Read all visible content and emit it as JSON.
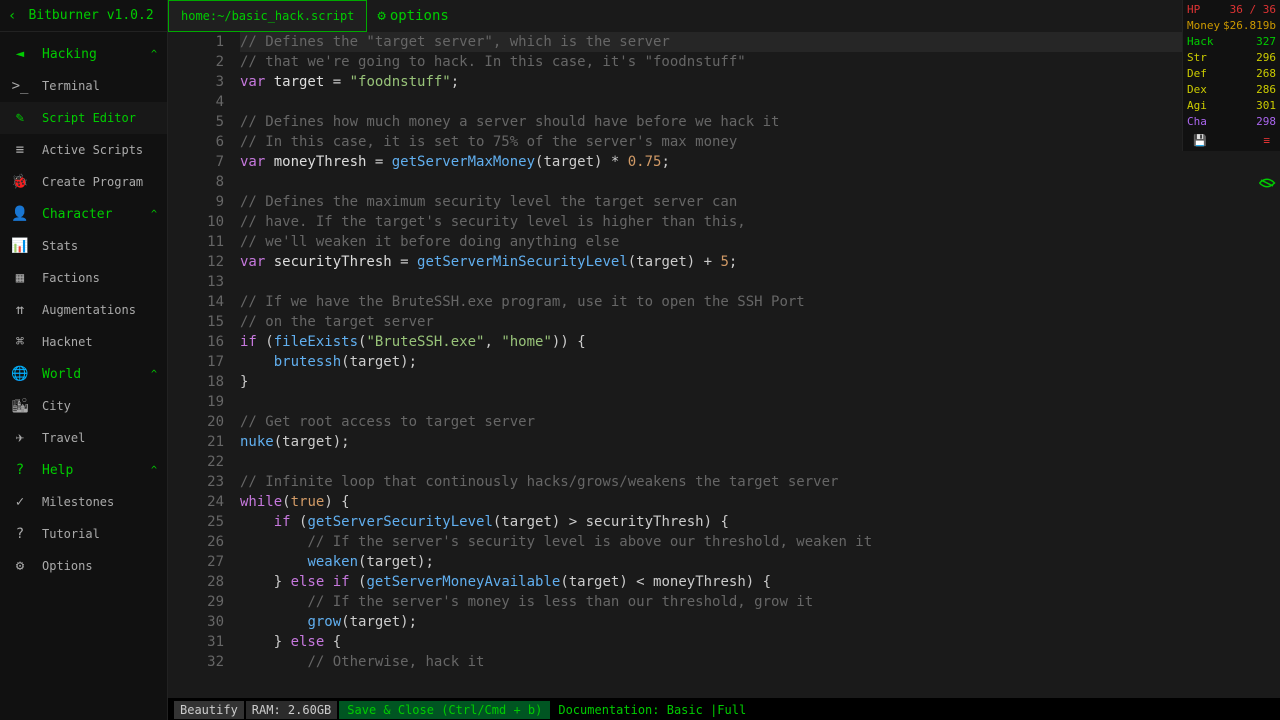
{
  "title": "Bitburner v1.0.2",
  "tab": {
    "path": "home:~/basic_hack.script",
    "options": "options"
  },
  "sidebar": {
    "groups": [
      {
        "label": "Hacking",
        "icon": "back-icon",
        "items": [
          {
            "label": "Terminal",
            "icon": "caret-icon"
          },
          {
            "label": "Script Editor",
            "icon": "edit-icon",
            "active": true
          },
          {
            "label": "Active Scripts",
            "icon": "storage-icon"
          },
          {
            "label": "Create Program",
            "icon": "bug-icon"
          }
        ]
      },
      {
        "label": "Character",
        "icon": "person-icon",
        "items": [
          {
            "label": "Stats",
            "icon": "stats-icon"
          },
          {
            "label": "Factions",
            "icon": "contacts-icon"
          },
          {
            "label": "Augmentations",
            "icon": "double-arrow-icon"
          },
          {
            "label": "Hacknet",
            "icon": "account-tree-icon"
          }
        ]
      },
      {
        "label": "World",
        "icon": "globe-icon",
        "items": [
          {
            "label": "City",
            "icon": "city-icon"
          },
          {
            "label": "Travel",
            "icon": "plane-icon"
          }
        ]
      },
      {
        "label": "Help",
        "icon": "help-icon",
        "items": [
          {
            "label": "Milestones",
            "icon": "check-icon"
          },
          {
            "label": "Tutorial",
            "icon": "question-icon"
          },
          {
            "label": "Options",
            "icon": "gear-icon"
          }
        ]
      }
    ]
  },
  "code_lines": [
    {
      "n": 1,
      "hl": true,
      "t": [
        [
          "cm",
          "// Defines the \"target server\", which is the server"
        ]
      ]
    },
    {
      "n": 2,
      "t": [
        [
          "cm",
          "// that we're going to hack. In this case, it's \"foodnstuff\""
        ]
      ]
    },
    {
      "n": 3,
      "t": [
        [
          "kw",
          "var "
        ],
        [
          "id",
          "target"
        ],
        [
          "pn",
          " = "
        ],
        [
          "str",
          "\"foodnstuff\""
        ],
        [
          "pn",
          ";"
        ]
      ]
    },
    {
      "n": 4,
      "t": []
    },
    {
      "n": 5,
      "t": [
        [
          "cm",
          "// Defines how much money a server should have before we hack it"
        ]
      ]
    },
    {
      "n": 6,
      "t": [
        [
          "cm",
          "// In this case, it is set to 75% of the server's max money"
        ]
      ]
    },
    {
      "n": 7,
      "t": [
        [
          "kw",
          "var "
        ],
        [
          "id",
          "moneyThresh"
        ],
        [
          "pn",
          " = "
        ],
        [
          "fn",
          "getServerMaxMoney"
        ],
        [
          "pn",
          "(target) * "
        ],
        [
          "num",
          "0.75"
        ],
        [
          "pn",
          ";"
        ]
      ]
    },
    {
      "n": 8,
      "t": []
    },
    {
      "n": 9,
      "t": [
        [
          "cm",
          "// Defines the maximum security level the target server can"
        ]
      ]
    },
    {
      "n": 10,
      "t": [
        [
          "cm",
          "// have. If the target's security level is higher than this,"
        ]
      ]
    },
    {
      "n": 11,
      "t": [
        [
          "cm",
          "// we'll weaken it before doing anything else"
        ]
      ]
    },
    {
      "n": 12,
      "t": [
        [
          "kw",
          "var "
        ],
        [
          "id",
          "securityThresh"
        ],
        [
          "pn",
          " = "
        ],
        [
          "fn",
          "getServerMinSecurityLevel"
        ],
        [
          "pn",
          "(target) + "
        ],
        [
          "num",
          "5"
        ],
        [
          "pn",
          ";"
        ]
      ]
    },
    {
      "n": 13,
      "t": []
    },
    {
      "n": 14,
      "t": [
        [
          "cm",
          "// If we have the BruteSSH.exe program, use it to open the SSH Port"
        ]
      ]
    },
    {
      "n": 15,
      "t": [
        [
          "cm",
          "// on the target server"
        ]
      ]
    },
    {
      "n": 16,
      "t": [
        [
          "kw",
          "if"
        ],
        [
          "pn",
          " ("
        ],
        [
          "fn",
          "fileExists"
        ],
        [
          "pn",
          "("
        ],
        [
          "str",
          "\"BruteSSH.exe\""
        ],
        [
          "pn",
          ", "
        ],
        [
          "str",
          "\"home\""
        ],
        [
          "pn",
          ")) {"
        ]
      ]
    },
    {
      "n": 17,
      "t": [
        [
          "pn",
          "    "
        ],
        [
          "fn",
          "brutessh"
        ],
        [
          "pn",
          "(target);"
        ]
      ]
    },
    {
      "n": 18,
      "t": [
        [
          "pn",
          "}"
        ]
      ]
    },
    {
      "n": 19,
      "t": []
    },
    {
      "n": 20,
      "t": [
        [
          "cm",
          "// Get root access to target server"
        ]
      ]
    },
    {
      "n": 21,
      "t": [
        [
          "fn",
          "nuke"
        ],
        [
          "pn",
          "(target);"
        ]
      ]
    },
    {
      "n": 22,
      "t": []
    },
    {
      "n": 23,
      "t": [
        [
          "cm",
          "// Infinite loop that continously hacks/grows/weakens the target server"
        ]
      ]
    },
    {
      "n": 24,
      "t": [
        [
          "kw",
          "while"
        ],
        [
          "pn",
          "("
        ],
        [
          "num",
          "true"
        ],
        [
          "pn",
          ") {"
        ]
      ]
    },
    {
      "n": 25,
      "t": [
        [
          "pn",
          "    "
        ],
        [
          "kw",
          "if"
        ],
        [
          "pn",
          " ("
        ],
        [
          "fn",
          "getServerSecurityLevel"
        ],
        [
          "pn",
          "(target) > securityThresh) {"
        ]
      ]
    },
    {
      "n": 26,
      "t": [
        [
          "pn",
          "        "
        ],
        [
          "cm",
          "// If the server's security level is above our threshold, weaken it"
        ]
      ]
    },
    {
      "n": 27,
      "t": [
        [
          "pn",
          "        "
        ],
        [
          "fn",
          "weaken"
        ],
        [
          "pn",
          "(target);"
        ]
      ]
    },
    {
      "n": 28,
      "t": [
        [
          "pn",
          "    } "
        ],
        [
          "kw",
          "else if"
        ],
        [
          "pn",
          " ("
        ],
        [
          "fn",
          "getServerMoneyAvailable"
        ],
        [
          "pn",
          "(target) < moneyThresh) {"
        ]
      ]
    },
    {
      "n": 29,
      "t": [
        [
          "pn",
          "        "
        ],
        [
          "cm",
          "// If the server's money is less than our threshold, grow it"
        ]
      ]
    },
    {
      "n": 30,
      "t": [
        [
          "pn",
          "        "
        ],
        [
          "fn",
          "grow"
        ],
        [
          "pn",
          "(target);"
        ]
      ]
    },
    {
      "n": 31,
      "t": [
        [
          "pn",
          "    } "
        ],
        [
          "kw",
          "else"
        ],
        [
          "pn",
          " {"
        ]
      ]
    },
    {
      "n": 32,
      "t": [
        [
          "pn",
          "        "
        ],
        [
          "cm",
          "// Otherwise, hack it"
        ]
      ]
    }
  ],
  "status": {
    "beautify": "Beautify",
    "ram": "RAM: 2.60GB",
    "save": "Save & Close (Ctrl/Cmd + b)",
    "doc": "Documentation: Basic |Full"
  },
  "stats": {
    "hp": {
      "label": "HP",
      "value": "36 / 36"
    },
    "money": {
      "label": "Money",
      "value": "$26.819b"
    },
    "hack": {
      "label": "Hack",
      "value": "327"
    },
    "str": {
      "label": "Str",
      "value": "296"
    },
    "def": {
      "label": "Def",
      "value": "268"
    },
    "dex": {
      "label": "Dex",
      "value": "286"
    },
    "agi": {
      "label": "Agi",
      "value": "301"
    },
    "cha": {
      "label": "Cha",
      "value": "298"
    }
  }
}
